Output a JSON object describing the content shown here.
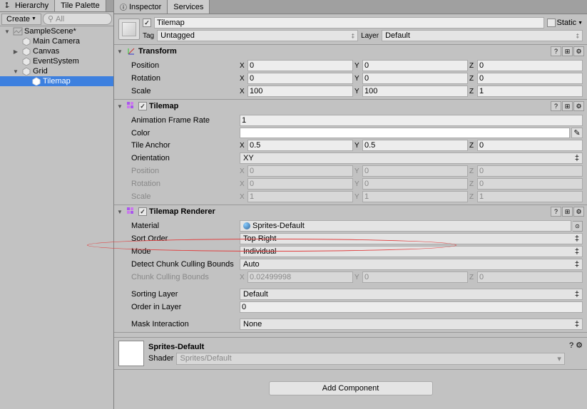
{
  "hierarchy_tab": "Hierarchy",
  "tile_palette_tab": "Tile Palette",
  "create_label": "Create",
  "search_placeholder": "All",
  "hierarchy": {
    "scene": "SampleScene*",
    "items": [
      "Main Camera",
      "Canvas",
      "EventSystem",
      "Grid",
      "Tilemap"
    ]
  },
  "inspector_tab": "Inspector",
  "services_tab": "Services",
  "object_name": "Tilemap",
  "static_label": "Static",
  "tag_label": "Tag",
  "tag_value": "Untagged",
  "layer_label": "Layer",
  "layer_value": "Default",
  "transform": {
    "title": "Transform",
    "position": {
      "label": "Position",
      "x": "0",
      "y": "0",
      "z": "0"
    },
    "rotation": {
      "label": "Rotation",
      "x": "0",
      "y": "0",
      "z": "0"
    },
    "scale": {
      "label": "Scale",
      "x": "100",
      "y": "100",
      "z": "1"
    }
  },
  "tilemap": {
    "title": "Tilemap",
    "frame_rate": {
      "label": "Animation Frame Rate",
      "value": "1"
    },
    "color_label": "Color",
    "anchor": {
      "label": "Tile Anchor",
      "x": "0.5",
      "y": "0.5",
      "z": "0"
    },
    "orientation": {
      "label": "Orientation",
      "value": "XY"
    },
    "position": {
      "label": "Position",
      "x": "0",
      "y": "0",
      "z": "0"
    },
    "rotation": {
      "label": "Rotation",
      "x": "0",
      "y": "0",
      "z": "0"
    },
    "scale": {
      "label": "Scale",
      "x": "1",
      "y": "1",
      "z": "1"
    }
  },
  "renderer": {
    "title": "Tilemap Renderer",
    "material": {
      "label": "Material",
      "value": "Sprites-Default"
    },
    "sort_order": {
      "label": "Sort Order",
      "value": "Top Right"
    },
    "mode": {
      "label": "Mode",
      "value": "Individual"
    },
    "detect": {
      "label": "Detect Chunk Culling Bounds",
      "value": "Auto"
    },
    "bounds": {
      "label": "Chunk Culling Bounds",
      "x": "0.02499998",
      "y": "0",
      "z": "0"
    },
    "sorting_layer": {
      "label": "Sorting Layer",
      "value": "Default"
    },
    "order": {
      "label": "Order in Layer",
      "value": "0"
    },
    "mask": {
      "label": "Mask Interaction",
      "value": "None"
    }
  },
  "material_preview": {
    "name": "Sprites-Default",
    "shader_label": "Shader",
    "shader_value": "Sprites/Default"
  },
  "add_component": "Add Component"
}
